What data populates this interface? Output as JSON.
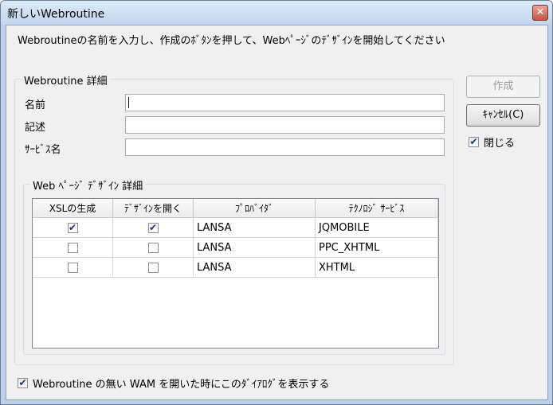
{
  "window": {
    "title": "新しいWebroutine"
  },
  "instruction": "Webroutineの名前を入力し、作成のﾎﾞﾀﾝを押して、Webﾍﾟｰｼﾞのﾃﾞｻﾞｲﾝを開始してください",
  "details_group": {
    "legend": "Webroutine 詳細",
    "name_label": "名前",
    "name_value": "",
    "description_label": "記述",
    "description_value": "",
    "service_name_label": "ｻｰﾋﾞｽ名",
    "service_name_value": ""
  },
  "buttons": {
    "create": "作成",
    "cancel": "ｷｬﾝｾﾙ(C)"
  },
  "close_checkbox": {
    "label": "閉じる",
    "checked": true
  },
  "design_group": {
    "legend": "Web ﾍﾟｰｼﾞ ﾃﾞｻﾞｲﾝ 詳細",
    "columns": [
      "XSLの生成",
      "ﾃﾞｻﾞｲﾝを開く",
      "ﾌﾟﾛﾊﾞｲﾀﾞ",
      "ﾃｸﾉﾛｼﾞ ｻｰﾋﾞｽ"
    ],
    "rows": [
      {
        "xsl": true,
        "open": true,
        "provider": "LANSA",
        "service": "JQMOBILE"
      },
      {
        "xsl": false,
        "open": false,
        "provider": "LANSA",
        "service": "PPC_XHTML"
      },
      {
        "xsl": false,
        "open": false,
        "provider": "LANSA",
        "service": "XHTML"
      }
    ]
  },
  "bottom_checkbox": {
    "label": "Webroutine の無い WAM を開いた時にこのﾀﾞｲｱﾛｸﾞを表示する",
    "checked": true
  }
}
